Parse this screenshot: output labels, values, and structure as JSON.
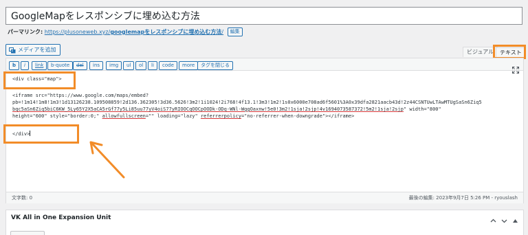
{
  "post": {
    "title": "GoogleMapをレスポンシブに埋め込む方法"
  },
  "permalink": {
    "label": "パーマリンク:",
    "base_url": "https://plusoneweb.xyz/",
    "slug": "googlemapをレスポンシブに埋め込む方法",
    "trailing_slash": "/",
    "edit_label": "編集"
  },
  "media": {
    "add_label": "メディアを追加"
  },
  "editor_tabs": {
    "visual": "ビジュアル",
    "text": "テキスト"
  },
  "quicktags": [
    "b",
    "i",
    "link",
    "b-quote",
    "del",
    "ins",
    "img",
    "ul",
    "ol",
    "li",
    "code",
    "more",
    "タグを閉じる"
  ],
  "code": {
    "line1": "<div class=\"map\">",
    "line2": "<iframe src=\"https://www.google.com/maps/embed?",
    "line3": "pb=!1m14!1m8!1m3!1d13126238.109508859!2d136.362305!3d36.5626!3m2!1i1024!2i768!4f13.1!3m3!1m2!1s0x6000e708ad6f5601%3A0x39dfa2821aacb43d!2z44CSNTUwLTAwMTUgSaSn6Ziq5",
    "line4_a": "bqc5aSn6Ziq5biC6KW_5Ly65Y2X5aCA5rGf77y5Li85uu77yV4oiS77yRIOOCqOOCpOODk-ODq-WNl-WggOaxnw!5e0!3m2!1sja!2sjp!4v1694073587372!5m2!1sja!2sjp",
    "line4_b": "\" width=\"800\"",
    "line5_a": "height=\"600\" style=\"border:0;\" ",
    "line5_b": "allowfullscreen",
    "line5_c": "=\"\" loading=\"lazy\" ",
    "line5_d": "referrerpolicy",
    "line5_e": "=\"no-referrer-when-downgrade\"></iframe>",
    "line6": "</div>"
  },
  "status": {
    "word_count": "文字数: 0",
    "last_edit": "最後の編集: 2023年9月7日 5:26 PM - ryouslash"
  },
  "metabox": {
    "title": "VK All in One Expansion Unit"
  },
  "colors": {
    "highlight": "#f28c28",
    "link": "#2271b1"
  },
  "icons": [
    "media-icon",
    "fullscreen-icon",
    "chevron-up-icon",
    "chevron-down-icon",
    "triangle-up-icon",
    "arrow-icon"
  ]
}
